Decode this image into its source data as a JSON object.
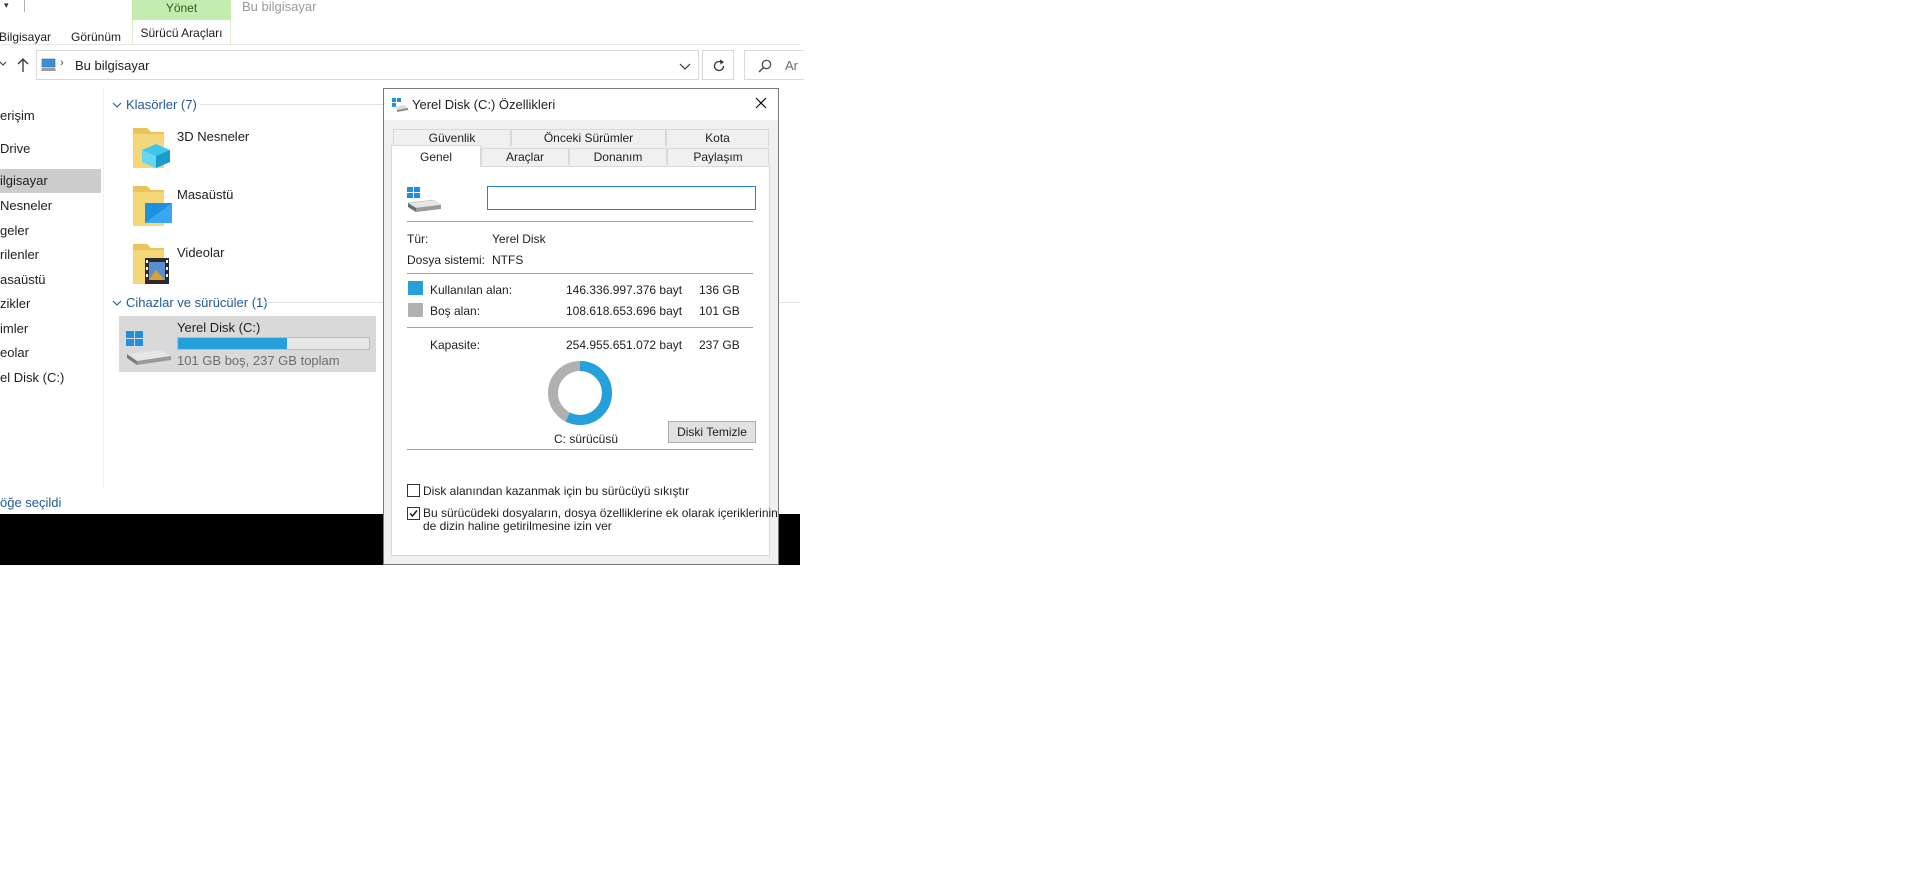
{
  "ribbon": {
    "manage_tab": "Yönet",
    "window_title": "Bu bilgisayar",
    "tabs": [
      "Bilgisayar",
      "Görünüm",
      "Sürücü Araçları"
    ]
  },
  "addressbar": {
    "path": "Bu bilgisayar",
    "search_placeholder": "Ar"
  },
  "sidebar": {
    "items": [
      "erişim",
      "Drive",
      "ilgisayar",
      "Nesneler",
      "geler",
      "rilenler",
      "asaüstü",
      "zikler",
      "imler",
      "eolar",
      "el Disk (C:)"
    ]
  },
  "content": {
    "folders_header": "Klasörler (7)",
    "folders": [
      "3D Nesneler",
      "Masaüstü",
      "Videolar"
    ],
    "devices_header": "Cihazlar ve sürücüler (1)",
    "drive": {
      "name": "Yerel Disk (C:)",
      "summary": "101 GB boş, 237 GB toplam",
      "used_fraction": 0.57
    }
  },
  "statusbar": {
    "text": "öğe seçildi"
  },
  "dialog": {
    "title": "Yerel Disk (C:) Özellikleri",
    "tabs_back": [
      "Güvenlik",
      "Önceki Sürümler",
      "Kota"
    ],
    "tabs_front": [
      "Genel",
      "Araçlar",
      "Donanım",
      "Paylaşım"
    ],
    "name_value": "",
    "type_label": "Tür:",
    "type_value": "Yerel Disk",
    "fs_label": "Dosya sistemi:",
    "fs_value": "NTFS",
    "used_label": "Kullanılan alan:",
    "used_bytes": "146.336.997.376 bayt",
    "used_gb": "136 GB",
    "free_label": "Boş alan:",
    "free_bytes": "108.618.653.696 bayt",
    "free_gb": "101 GB",
    "capacity_label": "Kapasite:",
    "capacity_bytes": "254.955.651.072 bayt",
    "capacity_gb": "237 GB",
    "used_fraction": 0.574,
    "drive_label": "C: sürücüsü",
    "cleanup_button": "Diski Temizle",
    "compress_label": "Disk alanından kazanmak için bu sürücüyü sıkıştır",
    "compress_checked": false,
    "index_label_1": "Bu sürücüdeki dosyaların, dosya özelliklerine ek olarak içeriklerinin",
    "index_label_2": "de dizin haline getirilmesine izin ver",
    "index_checked": true,
    "colors": {
      "used": "#26a0da",
      "free": "#b0b0b0"
    }
  }
}
